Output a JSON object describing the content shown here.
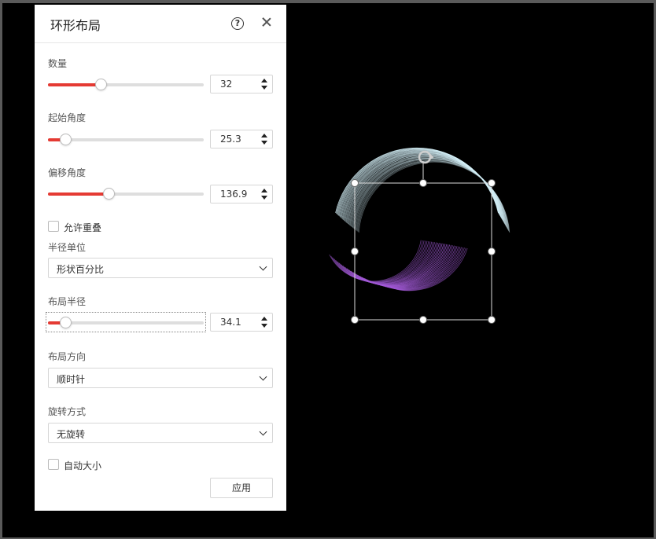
{
  "panel": {
    "title": "环形布局",
    "help_icon": "question-circle-icon",
    "close_icon": "close-icon"
  },
  "count": {
    "label": "数量",
    "value": "32",
    "slider_fraction": 0.34
  },
  "start_angle": {
    "label": "起始角度",
    "value": "25.3",
    "slider_fraction": 0.11
  },
  "offset_angle": {
    "label": "偏移角度",
    "value": "136.9",
    "slider_fraction": 0.39
  },
  "allow_overlap": {
    "label": "允许重叠",
    "checked": false
  },
  "radius_unit": {
    "label": "半径单位",
    "selected": "形状百分比"
  },
  "layout_radius": {
    "label": "布局半径",
    "value": "34.1",
    "slider_fraction": 0.11
  },
  "layout_direction": {
    "label": "布局方向",
    "selected": "顺时针"
  },
  "rotation_mode": {
    "label": "旋转方式",
    "selected": "无旋转"
  },
  "auto_size": {
    "label": "自动大小",
    "checked": false
  },
  "apply_label": "应用",
  "colors": {
    "accent": "#e53a33",
    "stroke_light": "#d4f0f8",
    "stroke_purple": "#a35ad8",
    "canvas_bg": "#000000"
  }
}
